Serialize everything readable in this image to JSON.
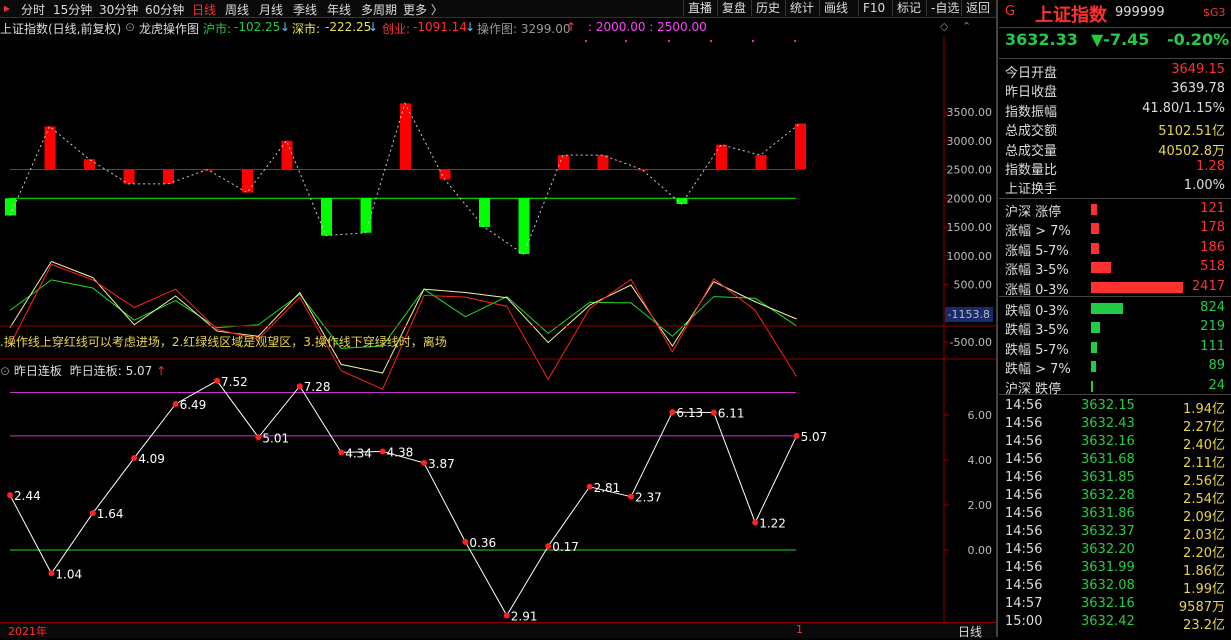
{
  "periods": [
    "分时",
    "15分钟",
    "30分钟",
    "60分钟",
    "日线",
    "周线",
    "月线",
    "季线",
    "年线",
    "多周期",
    "更多 〉"
  ],
  "active_period": "日线",
  "toolbar": [
    "直播",
    "复盘",
    "历史",
    "统计",
    "画线",
    "F10",
    "标记",
    "-自选",
    "返回"
  ],
  "info": {
    "title": "上证指数(日线,前复权)",
    "indicator": "龙虎操作图",
    "sh_label": "沪市:",
    "sh_val": "-102.25",
    "sz_label": "深市:",
    "sz_val": "-222.25",
    "cy_label": "创业:",
    "cy_val": "-1091.14",
    "op_label": "操作图: 3299.00",
    "lines_label": ": 2000.00 : 2500.00"
  },
  "note": ".操作线上穿红线可以考虑进场，2.红绿线区域是观望区，3.操作线下穿绿线时，离场",
  "lower": {
    "title": "昨日连板",
    "label": "昨日连板: 5.07"
  },
  "bottom": {
    "year": "2021年",
    "marker": "1",
    "mode": "日线"
  },
  "right_axis": {
    "upper": [
      "3500.00",
      "3000.00",
      "2500.00",
      "2000.00",
      "1500.00",
      "1000.00",
      "500.00",
      "0.00",
      "-500.00"
    ],
    "cur_label": "-1153.8",
    "lower": [
      "6.00",
      "4.00",
      "2.00",
      "0.00"
    ]
  },
  "chart_data": {
    "type": "bar",
    "histogram": {
      "baseline": 2000,
      "values": [
        1700,
        3250,
        2680,
        2250,
        2250,
        2500,
        2100,
        3000,
        1350,
        1400,
        3650,
        2330,
        1500,
        1030,
        2750,
        2750,
        2500,
        1900,
        2930,
        2750,
        3300
      ]
    },
    "lines": {
      "red": [
        -550,
        850,
        580,
        100,
        420,
        -280,
        -450,
        280,
        -1000,
        -1320,
        310,
        280,
        120,
        -1150,
        80,
        590,
        -670,
        600,
        50,
        -1100
      ],
      "yellow": [
        -250,
        900,
        620,
        -200,
        300,
        -310,
        -400,
        360,
        -890,
        -1040,
        420,
        360,
        270,
        -510,
        140,
        490,
        -570,
        550,
        200,
        -100
      ],
      "green": [
        50,
        580,
        440,
        -120,
        220,
        -250,
        -200,
        330,
        -610,
        -570,
        420,
        -60,
        290,
        -350,
        190,
        180,
        -400,
        290,
        260,
        -220
      ]
    },
    "lower_series": {
      "values": [
        2.44,
        -1.04,
        1.64,
        4.09,
        6.49,
        7.52,
        5.01,
        7.28,
        4.34,
        4.38,
        3.87,
        0.36,
        -2.91,
        0.17,
        2.81,
        2.37,
        6.13,
        6.11,
        1.22,
        5.07
      ],
      "labels": [
        "2.44",
        "1.04",
        "1.64",
        "4.09",
        "6.49",
        "7.52",
        "5.01",
        "7.28",
        "4.34",
        "4.38",
        "3.87",
        "0.36",
        "2.91",
        "0.17",
        "2.81",
        "2.37",
        "6.13",
        "6.11",
        "1.22",
        "5.07"
      ],
      "hlines": [
        7,
        5.07,
        0
      ]
    }
  },
  "quote": {
    "icon": "G",
    "name": "上证指数",
    "code": "999999",
    "tag": "$G3",
    "price": "3632.33",
    "change": "▼-7.45",
    "pct": "-0.20%",
    "rows": [
      {
        "k": "今日开盘",
        "v": "3649.15",
        "c": "#ff3030"
      },
      {
        "k": "昨日收盘",
        "v": "3639.78",
        "c": "#dddddd"
      },
      {
        "k": "指数振幅",
        "v": "41.80/1.15%",
        "c": "#dddddd"
      },
      {
        "k": "总成交额",
        "v": "5102.51亿",
        "c": "#e8d44d"
      },
      {
        "k": "总成交量",
        "v": "40502.8万",
        "c": "#e8d44d"
      },
      {
        "k": "指数量比",
        "v": "1.28",
        "c": "#ff3030"
      },
      {
        "k": "上证换手",
        "v": "1.00%",
        "c": "#dddddd"
      }
    ],
    "breadth": [
      {
        "k": "沪深 涨停",
        "v": "121",
        "c": "#ff3030",
        "bar": 6
      },
      {
        "k": "涨幅 > 7%",
        "v": "178",
        "c": "#ff3030",
        "bar": 8
      },
      {
        "k": "涨幅 5-7%",
        "v": "186",
        "c": "#ff3030",
        "bar": 8
      },
      {
        "k": "涨幅 3-5%",
        "v": "518",
        "c": "#ff3030",
        "bar": 20
      },
      {
        "k": "涨幅 0-3%",
        "v": "2417",
        "c": "#ff3030",
        "bar": 92
      },
      {
        "k": "跌幅 0-3%",
        "v": "824",
        "c": "#22cc44",
        "bar": 32
      },
      {
        "k": "跌幅 3-5%",
        "v": "219",
        "c": "#22cc44",
        "bar": 9
      },
      {
        "k": "跌幅 5-7%",
        "v": "111",
        "c": "#22cc44",
        "bar": 6
      },
      {
        "k": "跌幅 > 7%",
        "v": "89",
        "c": "#22cc44",
        "bar": 5
      },
      {
        "k": "沪深 跌停",
        "v": "24",
        "c": "#22cc44",
        "bar": 2
      }
    ],
    "ticks": [
      {
        "t": "14:56",
        "p": "3632.15",
        "a": "1.94亿"
      },
      {
        "t": "14:56",
        "p": "3632.43",
        "a": "2.27亿"
      },
      {
        "t": "14:56",
        "p": "3632.16",
        "a": "2.40亿"
      },
      {
        "t": "14:56",
        "p": "3631.68",
        "a": "2.11亿"
      },
      {
        "t": "14:56",
        "p": "3631.85",
        "a": "2.56亿"
      },
      {
        "t": "14:56",
        "p": "3632.28",
        "a": "2.54亿"
      },
      {
        "t": "14:56",
        "p": "3631.86",
        "a": "2.09亿"
      },
      {
        "t": "14:56",
        "p": "3632.37",
        "a": "2.03亿"
      },
      {
        "t": "14:56",
        "p": "3632.20",
        "a": "2.20亿"
      },
      {
        "t": "14:56",
        "p": "3631.99",
        "a": "1.86亿"
      },
      {
        "t": "14:56",
        "p": "3632.08",
        "a": "1.99亿"
      },
      {
        "t": "14:57",
        "p": "3632.16",
        "a": "9587万"
      },
      {
        "t": "15:00",
        "p": "3632.42",
        "a": "23.2亿"
      }
    ]
  },
  "colors": {
    "up": "#ff3030",
    "down": "#22cc44",
    "bar_up": "#ff0000",
    "bar_down": "#00ff00",
    "magenta": "#cc33cc"
  }
}
